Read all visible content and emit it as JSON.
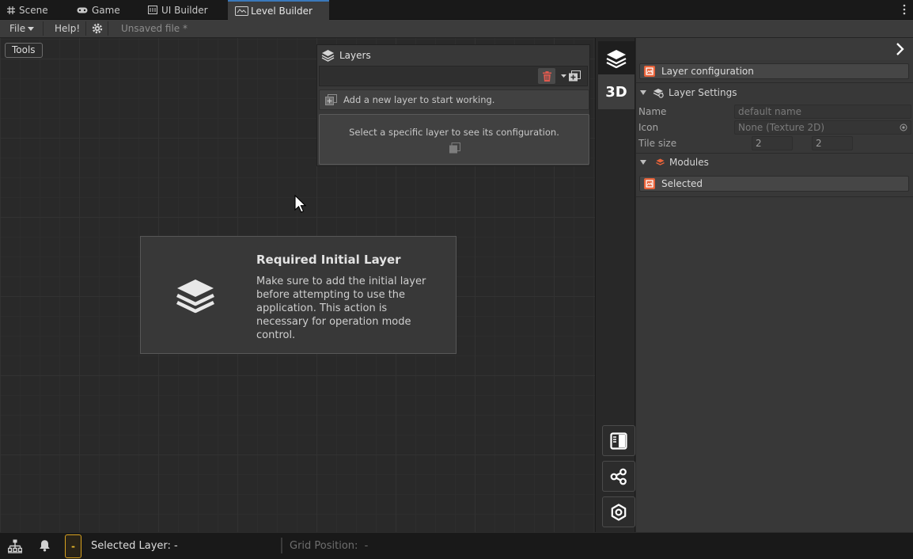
{
  "tabs": [
    {
      "label": "Scene",
      "icon": "grid-icon"
    },
    {
      "label": "Game",
      "icon": "gamepad-icon"
    },
    {
      "label": "UI Builder",
      "icon": "ui-builder-icon"
    },
    {
      "label": "Level Builder",
      "icon": "level-builder-icon",
      "active": true
    }
  ],
  "toolbar": {
    "file": "File",
    "help": "Help!",
    "unsaved": "Unsaved file *"
  },
  "canvas": {
    "tools_label": "Tools"
  },
  "layers_panel": {
    "title": "Layers",
    "add_hint": "Add a new layer to start working.",
    "select_hint": "Select a specific layer to see its configuration."
  },
  "modal": {
    "title": "Required Initial Layer",
    "body": "Make sure to add the initial layer before attempting to use the application. This action is necessary for operation mode control."
  },
  "strip": {
    "mode_3d": "3D"
  },
  "inspector": {
    "config_label": "Layer configuration",
    "settings_header": "Layer Settings",
    "name_label": "Name",
    "name_value": "default name",
    "icon_label": "Icon",
    "icon_value": "None (Texture 2D)",
    "tile_size_label": "Tile size",
    "tile_x": "2",
    "tile_y": "2",
    "modules_header": "Modules",
    "selected_label": "Selected"
  },
  "status": {
    "badge": "-",
    "selected_layer": "Selected Layer: -",
    "grid_position": "Grid Position:  -"
  },
  "colors": {
    "accent_orange": "#e8633a",
    "trash_red": "#e05a4f",
    "badge_yellow": "#e8b82a",
    "active_tab_blue": "#3a79bb"
  }
}
